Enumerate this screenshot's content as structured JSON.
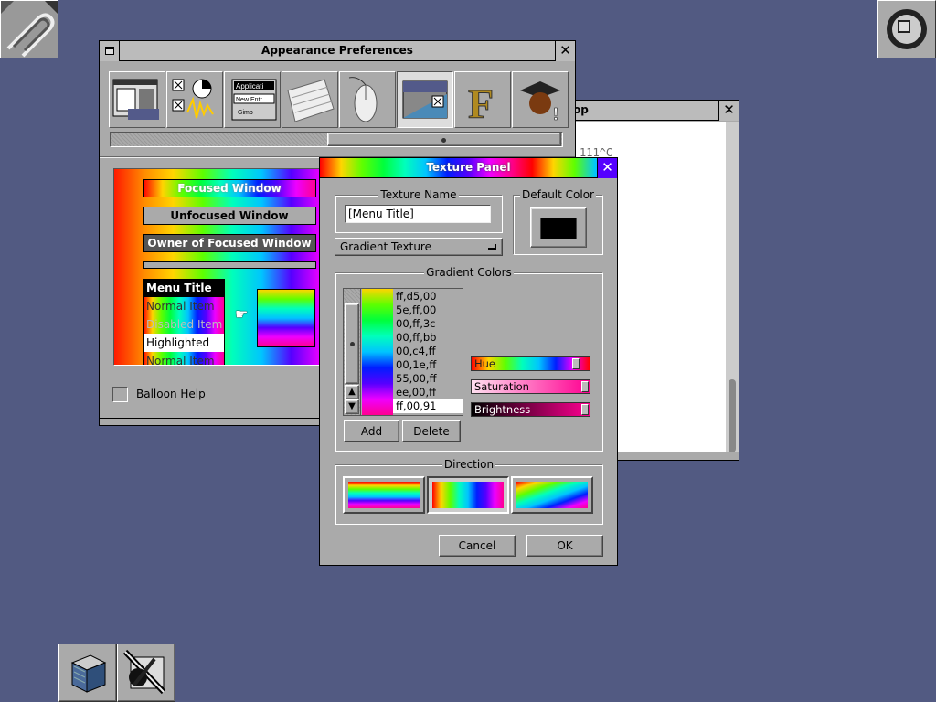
{
  "desktop": {
    "background": "#525a82"
  },
  "back_window": {
    "title_fragment": "op",
    "text_line": "111^C"
  },
  "appearance_window": {
    "title": "Appearance Preferences",
    "toolbar_icons": [
      {
        "name": "window-prefs-icon"
      },
      {
        "name": "workspace-prefs-icon"
      },
      {
        "name": "menu-prefs-icon",
        "labels": [
          "Applicati",
          "New Entr",
          "Gimp"
        ]
      },
      {
        "name": "keyboard-prefs-icon"
      },
      {
        "name": "mouse-prefs-icon"
      },
      {
        "name": "appearance-prefs-icon"
      },
      {
        "name": "font-prefs-icon",
        "label": "F"
      },
      {
        "name": "expert-prefs-icon",
        "label": "!"
      }
    ],
    "preview": {
      "focused": "Focused Window",
      "unfocused": "Unfocused Window",
      "owner": "Owner of Focused Window",
      "menu_title": "Menu Title",
      "normal_item": "Normal Item",
      "disabled_item": "Disabled Item",
      "highlighted": "Highlighted",
      "normal_item2": "Normal Item"
    },
    "balloon_help": "Balloon Help"
  },
  "texture_panel": {
    "title": "Texture Panel",
    "texture_name_label": "Texture Name",
    "texture_name_value": "[Menu Title]",
    "default_color_label": "Default Color",
    "default_color": "#000000",
    "texture_type": "Gradient Texture",
    "gradient_colors_label": "Gradient Colors",
    "colors": [
      "ff,d5,00",
      "5e,ff,00",
      "00,ff,3c",
      "00,ff,bb",
      "00,c4,ff",
      "00,1e,ff",
      "55,00,ff",
      "ee,00,ff",
      "ff,00,91"
    ],
    "selected_color_index": 8,
    "add_label": "Add",
    "delete_label": "Delete",
    "hue_label": "Hue",
    "saturation_label": "Saturation",
    "brightness_label": "Brightness",
    "direction_label": "Direction",
    "cancel_label": "Cancel",
    "ok_label": "OK"
  }
}
